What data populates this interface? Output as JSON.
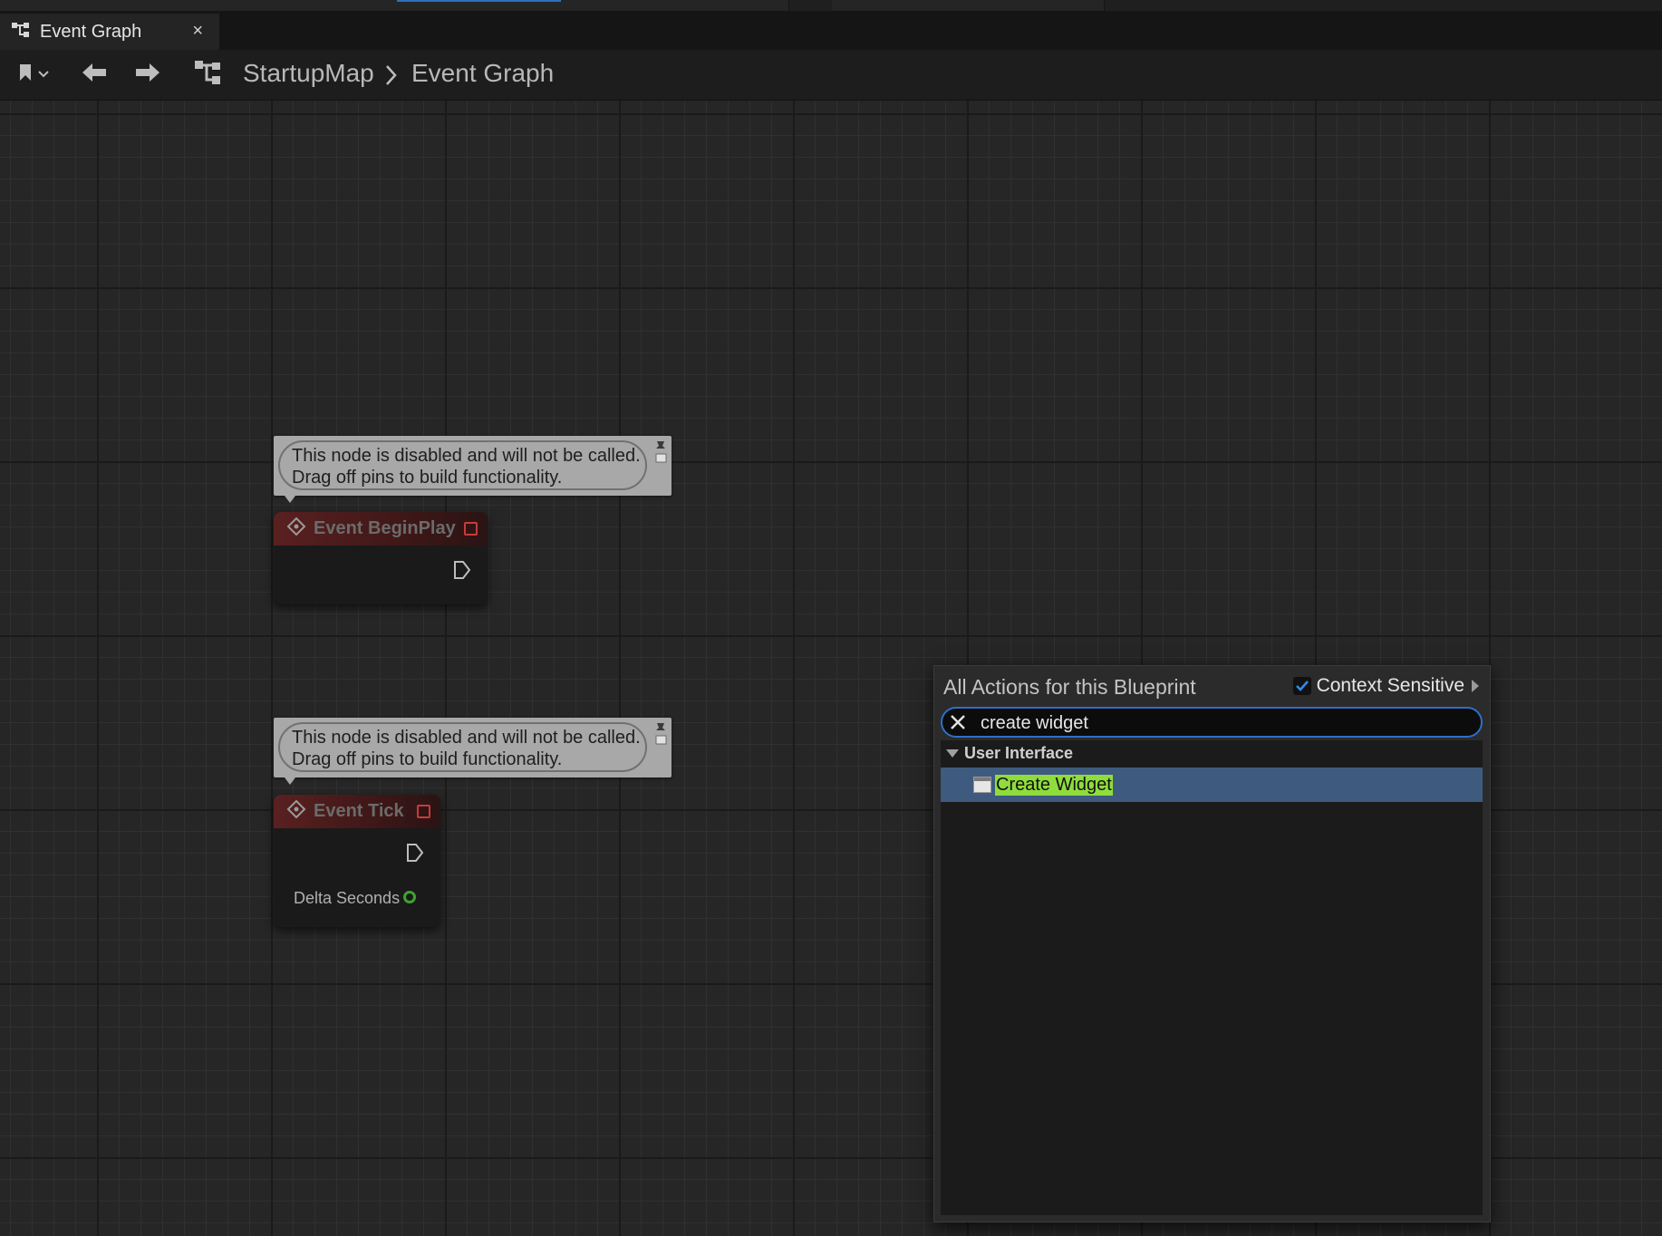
{
  "tab": {
    "label": "Event Graph",
    "close": "×"
  },
  "breadcrumb": {
    "root": "StartupMap",
    "current": "Event Graph"
  },
  "graph": {
    "comments": [
      {
        "line1": "This node is disabled and will not be called.",
        "line2": "Drag off pins to build functionality."
      },
      {
        "line1": "This node is disabled and will not be called.",
        "line2": "Drag off pins to build functionality."
      }
    ],
    "nodes": [
      {
        "title": "Event BeginPlay"
      },
      {
        "title": "Event Tick",
        "pin_label": "Delta Seconds"
      }
    ]
  },
  "action_menu": {
    "title": "All Actions for this Blueprint",
    "context_sensitive_label": "Context Sensitive",
    "context_sensitive_checked": true,
    "search_value": "create widget",
    "category": "User Interface",
    "result": "Create Widget",
    "highlight_color": "#8fdc3c",
    "selection_color": "#3e5b7f"
  }
}
